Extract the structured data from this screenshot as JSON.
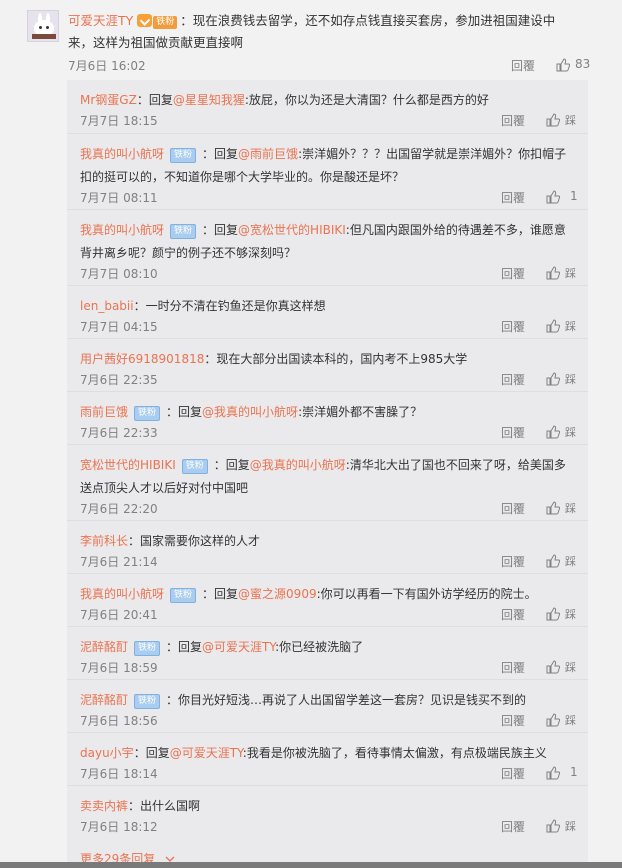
{
  "main": {
    "username": "可爱天涯TY",
    "badge": "铁粉",
    "text": "：现在浪费钱去留学，还不如存点钱直接买套房，参加进祖国建设中来，这样为祖国做贡献更直接啊",
    "time": "7月6日 16:02",
    "reply_label": "回覆",
    "likes": "83"
  },
  "replies": [
    {
      "name": "Mr钢蛋GZ",
      "fan": "",
      "pre": "：回复",
      "to": "@星星知我猩",
      "text": ":放屁，你以为还是大清国？什么都是西方的好",
      "time": "7月7日 18:15",
      "likes": "",
      "step": "踩"
    },
    {
      "name": "我真的叫小航呀",
      "fan": "铁粉",
      "pre": "：回复",
      "to": "@雨前巨饿",
      "text": ":崇洋媚外？？？出国留学就是崇洋媚外？你扣帽子扣的挺可以的，不知道你是哪个大学毕业的。你是酸还是坏？",
      "time": "7月7日 08:11",
      "likes": "1",
      "step": ""
    },
    {
      "name": "我真的叫小航呀",
      "fan": "铁粉",
      "pre": "：回复",
      "to": "@宽松世代的HIBIKI",
      "text": ":但凡国内跟国外给的待遇差不多，谁愿意背井离乡呢？颜宁的例子还不够深刻吗？",
      "time": "7月7日 08:10",
      "likes": "",
      "step": "踩"
    },
    {
      "name": "len_babii",
      "fan": "",
      "pre": "",
      "to": "",
      "text": "：一时分不清在钓鱼还是你真这样想",
      "time": "7月7日 04:15",
      "likes": "",
      "step": "踩"
    },
    {
      "name": "用户茜好6918901818",
      "fan": "",
      "pre": "",
      "to": "",
      "text": "：现在大部分出国读本科的，国内考不上985大学",
      "time": "7月6日 22:35",
      "likes": "",
      "step": "踩"
    },
    {
      "name": "雨前巨饿",
      "fan": "铁粉",
      "pre": "：回复",
      "to": "@我真的叫小航呀",
      "text": ":崇洋媚外都不害臊了？",
      "time": "7月6日 22:33",
      "likes": "",
      "step": "踩"
    },
    {
      "name": "宽松世代的HIBIKI",
      "fan": "铁粉",
      "pre": "：回复",
      "to": "@我真的叫小航呀",
      "text": ":清华北大出了国也不回来了呀，给美国多送点顶尖人才以后好对付中国吧",
      "time": "7月6日 22:20",
      "likes": "",
      "step": "踩"
    },
    {
      "name": "李前科长",
      "fan": "",
      "pre": "",
      "to": "",
      "text": "：国家需要你这样的人才",
      "time": "7月6日 21:14",
      "likes": "",
      "step": "踩"
    },
    {
      "name": "我真的叫小航呀",
      "fan": "铁粉",
      "pre": "：回复",
      "to": "@蜜之源0909",
      "text": ":你可以再看一下有国外访学经历的院士。",
      "time": "7月6日 20:41",
      "likes": "",
      "step": "踩"
    },
    {
      "name": "泥醉酩酊",
      "fan": "铁粉",
      "pre": "：回复",
      "to": "@可爱天涯TY",
      "text": ":你已经被洗脑了",
      "time": "7月6日 18:59",
      "likes": "",
      "step": "踩"
    },
    {
      "name": "泥醉酩酊",
      "fan": "铁粉",
      "pre": "",
      "to": "",
      "text": "：你目光好短浅…再说了人出国留学差这一套房？见识是钱买不到的",
      "time": "7月6日 18:56",
      "likes": "",
      "step": "踩"
    },
    {
      "name": "dayu小宇",
      "fan": "",
      "pre": "：回复",
      "to": "@可爱天涯TY",
      "text": ":我看是你被洗脑了，看待事情太偏激，有点极端民族主义",
      "time": "7月6日 18:14",
      "likes": "1",
      "step": ""
    },
    {
      "name": "卖卖内裤",
      "fan": "",
      "pre": "",
      "to": "",
      "text": "：出什么国啊",
      "time": "7月6日 18:12",
      "likes": "",
      "step": "踩"
    }
  ],
  "reply_label": "回覆",
  "more": "更多29条回复",
  "icons": {
    "like": "thumb-up-icon",
    "more": "chevron-down-icon",
    "verified": "verified-icon"
  },
  "colors": {
    "link": "#eb7350",
    "fan_badge": "#a9ccef",
    "gold_badge": "#f29c3f",
    "meta": "#808080"
  }
}
